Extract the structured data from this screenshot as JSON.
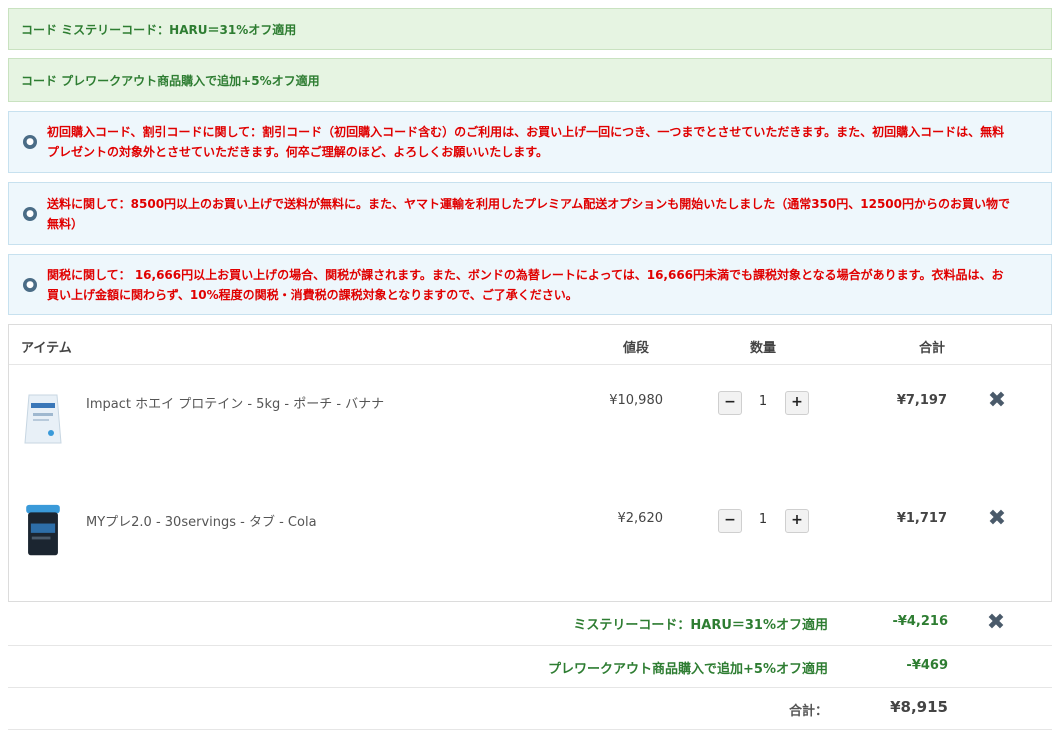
{
  "banners": {
    "code_mystery": "コード ミステリーコード：HARU＝31%オフ適用",
    "code_prework": "コード プレワークアウト商品購入で追加+5%オフ適用"
  },
  "notices": [
    {
      "text": "初回購入コード、割引コードに関して：割引コード（初回購入コード含む）のご利用は、お買い上げ一回につき、一つまでとさせていただきます。また、初回購入コードは、無料プレゼントの対象外とさせていただきます。何卒ご理解のほど、よろしくお願いいたします。"
    },
    {
      "text": "送料に関して：8500円以上のお買い上げで送料が無料に。また、ヤマト運輸を利用したプレミアム配送オプションも開始いたしました（通常350円、12500円からのお買い物で無料）"
    },
    {
      "text": "関税に関して： 16,666円以上お買い上げの場合、関税が課されます。また、ボンドの為替レートによっては、16,666円未満でも課税対象となる場合があります。衣料品は、お買い上げ金額に関わらず、10%程度の関税・消費税の課税対象となりますので、ご了承ください。"
    }
  ],
  "cart": {
    "headers": {
      "item": "アイテム",
      "price": "値段",
      "qty": "数量",
      "total": "合計"
    },
    "items": [
      {
        "name": "Impact ホエイ プロテイン - 5kg - ポーチ - バナナ",
        "price": "¥10,980",
        "qty": "1",
        "total": "¥7,197",
        "minus": "−",
        "plus": "+",
        "remove": "✖"
      },
      {
        "name": "MYプレ2.0 - 30servings - タブ - Cola",
        "price": "¥2,620",
        "qty": "1",
        "total": "¥1,717",
        "minus": "−",
        "plus": "+",
        "remove": "✖"
      }
    ]
  },
  "summary": {
    "discount1_label": "ミステリーコード：HARU＝31%オフ適用",
    "discount1_amount": "-¥4,216",
    "discount1_remove": "✖",
    "discount2_label": "プレワークアウト商品購入で追加+5%オフ適用",
    "discount2_amount": "-¥469",
    "total_label": "合計：",
    "total_amount": "¥8,915"
  },
  "colors": {
    "green_text": "#2e7d32",
    "notice_red": "#e00000",
    "info_bg": "#eef7fc",
    "green_bg": "#e6f4e2"
  },
  "icons": {
    "info": "info-icon",
    "remove": "remove-icon"
  }
}
